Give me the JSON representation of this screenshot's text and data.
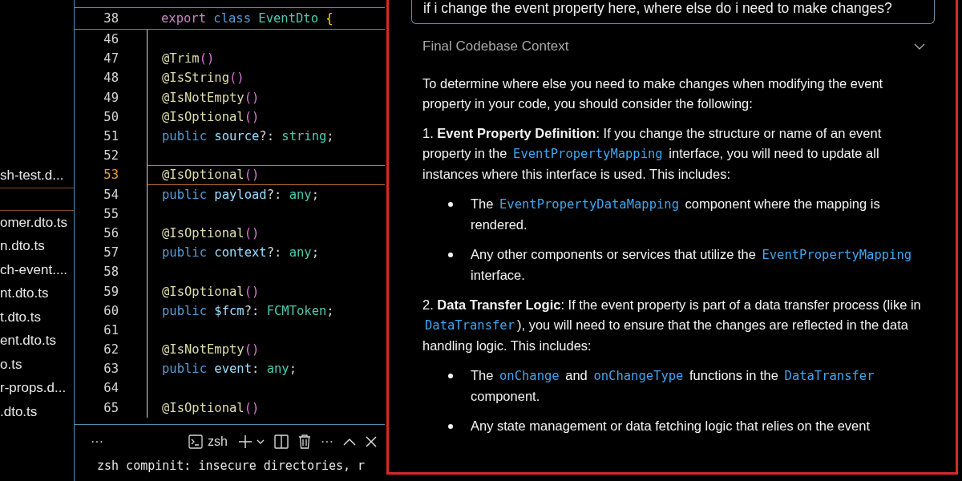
{
  "explorer": {
    "files": [
      {
        "name": "sh-test.d...",
        "selected": false
      },
      {
        "selected": true
      },
      {
        "name": "omer.dto.ts",
        "selected": false
      },
      {
        "name": "n.dto.ts",
        "selected": false
      },
      {
        "name": "ch-event....",
        "selected": false
      },
      {
        "name": "nt.dto.ts",
        "selected": false
      },
      {
        "name": "t.dto.ts",
        "selected": false
      },
      {
        "name": "ent.dto.ts",
        "selected": false
      },
      {
        "name": "o.ts",
        "selected": false
      },
      {
        "name": "r-props.d...",
        "selected": false
      },
      {
        "name": ".dto.ts",
        "selected": false
      }
    ]
  },
  "editor": {
    "sticky_line": {
      "number": "38",
      "tokens": [
        {
          "text": "export ",
          "kind": "export"
        },
        {
          "text": "class ",
          "kind": "keyword"
        },
        {
          "text": "EventDto ",
          "kind": "type"
        },
        {
          "text": "{",
          "kind": "brace"
        }
      ]
    },
    "lines": [
      {
        "number": "46",
        "current": false
      },
      {
        "number": "47",
        "current": false,
        "tokens": [
          {
            "text": "@Trim",
            "kind": "decorator"
          },
          {
            "text": "()",
            "kind": "paren"
          }
        ]
      },
      {
        "number": "48",
        "current": false,
        "tokens": [
          {
            "text": "@IsString",
            "kind": "decorator"
          },
          {
            "text": "()",
            "kind": "paren"
          }
        ]
      },
      {
        "number": "49",
        "current": false,
        "tokens": [
          {
            "text": "@IsNotEmpty",
            "kind": "decorator"
          },
          {
            "text": "()",
            "kind": "paren"
          }
        ]
      },
      {
        "number": "50",
        "current": false,
        "tokens": [
          {
            "text": "@IsOptional",
            "kind": "decorator"
          },
          {
            "text": "()",
            "kind": "paren"
          }
        ]
      },
      {
        "number": "51",
        "current": false,
        "tokens": [
          {
            "text": "public ",
            "kind": "keyword"
          },
          {
            "text": "source",
            "kind": "prop"
          },
          {
            "text": "?: ",
            "kind": "punct"
          },
          {
            "text": "string",
            "kind": "type"
          },
          {
            "text": ";",
            "kind": "punct"
          }
        ]
      },
      {
        "number": "52",
        "current": false
      },
      {
        "number": "53",
        "current": true,
        "tokens": [
          {
            "text": "@IsOptional",
            "kind": "decorator"
          },
          {
            "text": "()",
            "kind": "paren"
          }
        ]
      },
      {
        "number": "54",
        "current": false,
        "tokens": [
          {
            "text": "public ",
            "kind": "keyword"
          },
          {
            "text": "payload",
            "kind": "prop"
          },
          {
            "text": "?: ",
            "kind": "punct"
          },
          {
            "text": "any",
            "kind": "type"
          },
          {
            "text": ";",
            "kind": "punct"
          }
        ]
      },
      {
        "number": "55",
        "current": false
      },
      {
        "number": "56",
        "current": false,
        "tokens": [
          {
            "text": "@IsOptional",
            "kind": "decorator"
          },
          {
            "text": "()",
            "kind": "paren"
          }
        ]
      },
      {
        "number": "57",
        "current": false,
        "tokens": [
          {
            "text": "public ",
            "kind": "keyword"
          },
          {
            "text": "context",
            "kind": "prop"
          },
          {
            "text": "?: ",
            "kind": "punct"
          },
          {
            "text": "any",
            "kind": "type"
          },
          {
            "text": ";",
            "kind": "punct"
          }
        ]
      },
      {
        "number": "58",
        "current": false
      },
      {
        "number": "59",
        "current": false,
        "tokens": [
          {
            "text": "@IsOptional",
            "kind": "decorator"
          },
          {
            "text": "()",
            "kind": "paren"
          }
        ]
      },
      {
        "number": "60",
        "current": false,
        "tokens": [
          {
            "text": "public ",
            "kind": "keyword"
          },
          {
            "text": "$fcm",
            "kind": "prop"
          },
          {
            "text": "?: ",
            "kind": "punct"
          },
          {
            "text": "FCMToken",
            "kind": "type"
          },
          {
            "text": ";",
            "kind": "punct"
          }
        ]
      },
      {
        "number": "61",
        "current": false
      },
      {
        "number": "62",
        "current": false,
        "tokens": [
          {
            "text": "@IsNotEmpty",
            "kind": "decorator"
          },
          {
            "text": "()",
            "kind": "paren"
          }
        ]
      },
      {
        "number": "63",
        "current": false,
        "tokens": [
          {
            "text": "public ",
            "kind": "keyword"
          },
          {
            "text": "event",
            "kind": "prop"
          },
          {
            "text": ": ",
            "kind": "punct"
          },
          {
            "text": "any",
            "kind": "type"
          },
          {
            "text": ";",
            "kind": "punct"
          }
        ]
      },
      {
        "number": "64",
        "current": false
      },
      {
        "number": "65",
        "current": false,
        "tokens": [
          {
            "text": "@IsOptional",
            "kind": "decorator"
          },
          {
            "text": "()",
            "kind": "paren"
          }
        ]
      }
    ]
  },
  "terminal": {
    "more": "···",
    "shell": "zsh",
    "more_actions": "···",
    "output": "zsh compinit: insecure directories, r"
  },
  "chat": {
    "question": "if i change the event property here, where else do i need to make changes?",
    "context": {
      "title": "Final Codebase Context",
      "expanded": false
    },
    "answer": [
      {
        "kind": "paragraph",
        "segments": [
          {
            "text": "To determine where else you need to make changes when modifying the event property in your code, you should consider the following:",
            "kind": "plain"
          }
        ]
      },
      {
        "kind": "paragraph",
        "segments": [
          {
            "text": "1. ",
            "kind": "plain"
          },
          {
            "text": "Event Property Definition",
            "kind": "bold"
          },
          {
            "text": ": If you change the structure or name of an event property in the ",
            "kind": "plain"
          },
          {
            "text": "EventPropertyMapping",
            "kind": "code"
          },
          {
            "text": " interface, you will need to update all instances where this interface is used. This includes:",
            "kind": "plain"
          }
        ]
      },
      {
        "kind": "bullet",
        "segments": [
          {
            "text": "The ",
            "kind": "plain"
          },
          {
            "text": "EventPropertyDataMapping",
            "kind": "code"
          },
          {
            "text": " component where the mapping is rendered.",
            "kind": "plain"
          }
        ]
      },
      {
        "kind": "bullet",
        "segments": [
          {
            "text": "Any other components or services that utilize the ",
            "kind": "plain"
          },
          {
            "text": "EventPropertyMapping",
            "kind": "code"
          },
          {
            "text": " interface.",
            "kind": "plain"
          }
        ]
      },
      {
        "kind": "paragraph",
        "segments": [
          {
            "text": "2. ",
            "kind": "plain"
          },
          {
            "text": "Data Transfer Logic",
            "kind": "bold"
          },
          {
            "text": ": If the event property is part of a data transfer process (like in ",
            "kind": "plain"
          },
          {
            "text": "DataTransfer",
            "kind": "code"
          },
          {
            "text": "), you will need to ensure that the changes are reflected in the data handling logic. This includes:",
            "kind": "plain"
          }
        ]
      },
      {
        "kind": "bullet",
        "segments": [
          {
            "text": "The ",
            "kind": "plain"
          },
          {
            "text": "onChange",
            "kind": "code"
          },
          {
            "text": " and ",
            "kind": "plain"
          },
          {
            "text": "onChangeType",
            "kind": "code"
          },
          {
            "text": " functions in the ",
            "kind": "plain"
          },
          {
            "text": "DataTransfer",
            "kind": "code"
          },
          {
            "text": " component.",
            "kind": "plain"
          }
        ]
      },
      {
        "kind": "bullet",
        "segments": [
          {
            "text": "Any state management or data fetching logic that relies on the event",
            "kind": "plain"
          }
        ]
      }
    ]
  }
}
